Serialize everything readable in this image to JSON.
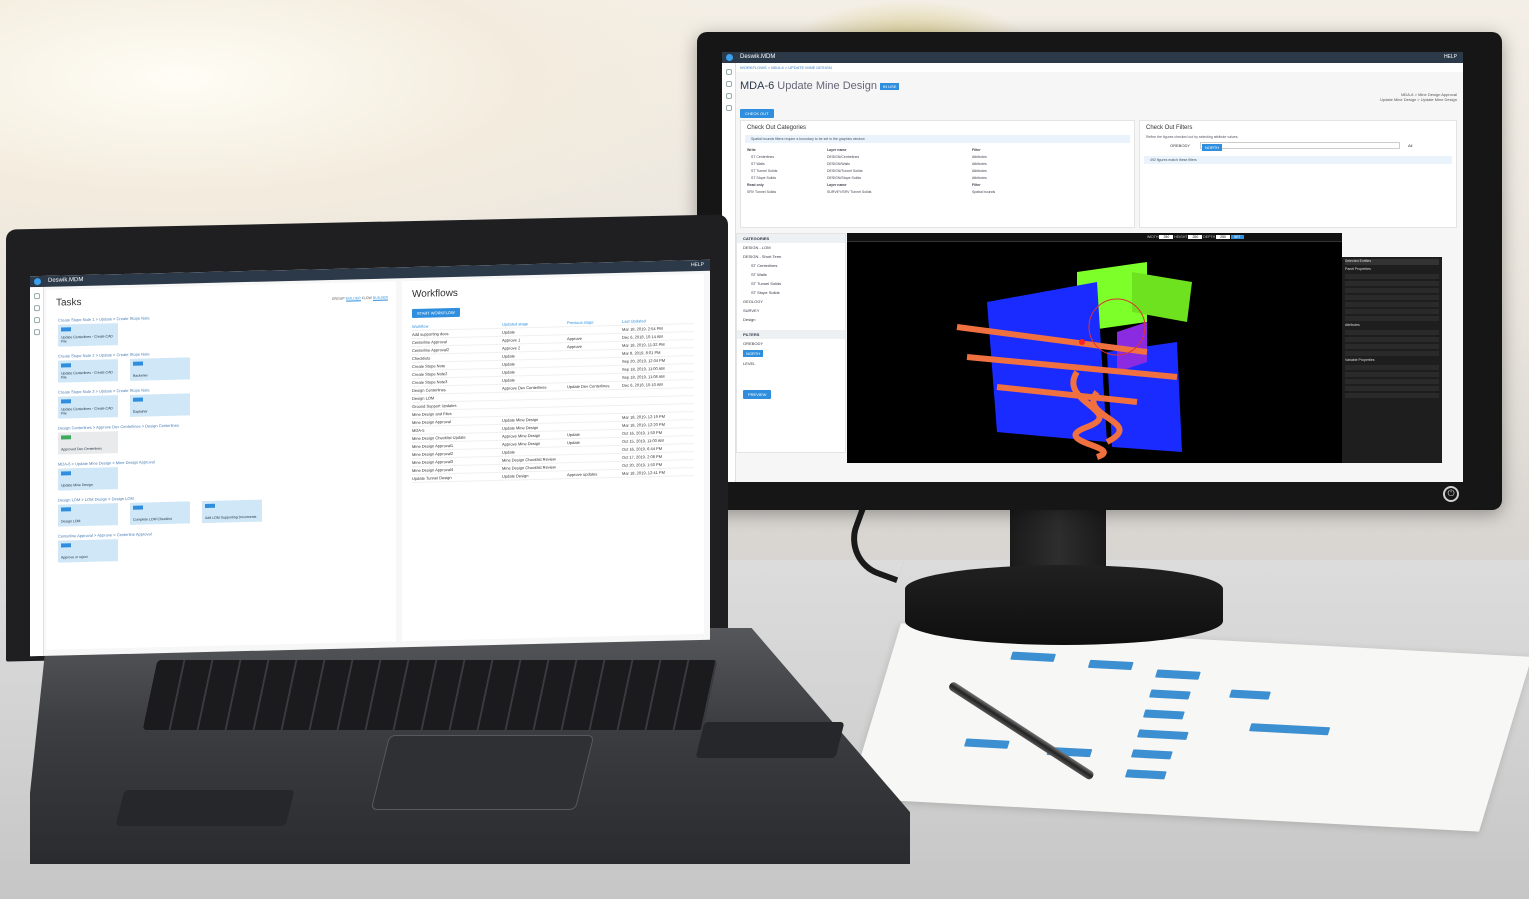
{
  "laptop_app": {
    "brand": "Deswik.MDM",
    "help": "HELP",
    "tasks": {
      "title": "Tasks",
      "filters": {
        "group_label": "GROUP",
        "group_value": "BUILDER",
        "flow_label": "FLOW",
        "flow_value": "BUILDER"
      },
      "rows": [
        {
          "header": "Create Stope Note 1 > Update > Create Stope Note",
          "cards": [
            "Update Centerlines - Create CAD File"
          ]
        },
        {
          "header": "Create Stope Note 2 > Update > Create Stope Note",
          "cards": [
            "Update Centerlines - Create CAD File",
            "Backener"
          ]
        },
        {
          "header": "Create Stope Note 3 > Update > Create Stope Note",
          "cards": [
            "Update Centerlines - Create CAD File",
            "Explainer"
          ]
        },
        {
          "header": "Design Centerlines > Approve Dev Centerlines > Design Centerlines",
          "cards": [
            "Approved Dev Centerlines"
          ]
        },
        {
          "header": "MDA-6 > Update Mine Design > Mine Design Approval",
          "cards": [
            "Update Mine Design"
          ]
        },
        {
          "header": "Design LOM > LOM Design > Design LOM",
          "cards": [
            "Design LOM",
            "Complete LOM Checklist",
            "Add LOM Supporting Documents"
          ]
        },
        {
          "header": "Centerline Approval > Approve > Centerline Approval",
          "cards": [
            "Approve or reject"
          ]
        }
      ]
    },
    "workflows": {
      "title": "Workflows",
      "start_button": "START WORKFLOW",
      "columns": [
        "Workflow",
        "Updated stage",
        "Previous stage",
        "Last Updated"
      ],
      "rows": [
        {
          "name": "Add supporting docs",
          "stage": "Update",
          "date": "Mar 18, 2019, 2:54 PM"
        },
        {
          "name": "Centerline Approval",
          "stage": "Approve 1",
          "prev": "Approve",
          "date": "Dec 6, 2018, 10:14 AM"
        },
        {
          "name": "Centerline Approval2",
          "stage": "Approve 2",
          "prev": "Approve",
          "date": "Mar 18, 2019, 11:32 PM"
        },
        {
          "name": "Checklists",
          "stage": "Update",
          "date": "Mar 8, 2019, 8:01 PM"
        },
        {
          "name": "Create Stope Note",
          "stage": "Update",
          "date": "Sep 20, 2019, 12:04 PM"
        },
        {
          "name": "Create Stope Note2",
          "stage": "Update",
          "date": "Sep 18, 2019, 11:00 AM"
        },
        {
          "name": "Create Stope Note3",
          "stage": "Update",
          "date": "Sep 18, 2019, 11:08 AM"
        },
        {
          "name": "Design Centerlines",
          "stage": "Approve Dev Centerlines",
          "prev": "Update Dev Centerlines",
          "date": "Dec 6, 2018, 10:10 AM"
        },
        {
          "name": "Design LOM",
          "stage": "",
          "date": ""
        },
        {
          "name": "Ground Support Updates",
          "stage": "",
          "date": ""
        },
        {
          "name": "Mine Design and Files",
          "stage": "",
          "date": ""
        },
        {
          "name": "Mine Design Approval",
          "stage": "Update Mine Design",
          "date": "Mar 18, 2019, 12:19 PM"
        },
        {
          "name": "MDA-5",
          "stage": "Update Mine Design",
          "date": "Mar 18, 2019, 12:20 PM"
        },
        {
          "name": "Mine Design Checklist Update",
          "stage": "Approve Mine Design",
          "prev": "Update",
          "date": "Oct 16, 2019, 1:50 PM"
        },
        {
          "name": "Mine Design Approval1",
          "stage": "Approve Mine Design",
          "prev": "Update",
          "date": "Oct 15, 2019, 11:00 AM"
        },
        {
          "name": "Mine Design Approval2",
          "stage": "Update",
          "date": "Oct 16, 2019, 6:44 PM"
        },
        {
          "name": "Mine Design Approval3",
          "stage": "Mine Design Checklist Review",
          "date": "Oct 17, 2019, 2:08 PM"
        },
        {
          "name": "Mine Design Approval4",
          "stage": "Mine Design Checklist Review",
          "date": "Oct 20, 2019, 1:50 PM"
        },
        {
          "name": "Update Tunnel Design",
          "stage": "Update Design",
          "prev": "Approve updates",
          "date": "Mar 18, 2019, 12:41 PM"
        }
      ]
    }
  },
  "monitor_app": {
    "brand": "Deswik.MDM",
    "help": "HELP",
    "breadcrumb": "WORKFLOWS > MDA-6 > UPDATE MINE DESIGN",
    "title_id": "MDA-6",
    "title_text": "Update Mine Design",
    "badge": "IN USE",
    "right_crumb_top": "MDA-6 > Mine Design Approval",
    "right_crumb_bottom": "Update Mine Design > Update Mine Design",
    "checkout_button": "CHECK OUT",
    "categories": {
      "title": "Check Out Categories",
      "info": "Spatial bounds filters require a boundary to be set in the graphics window",
      "write_label": "Write",
      "layer_label": "Layer name",
      "filter_label": "Filter",
      "write_rows": [
        {
          "name": "ST Centerlines",
          "layer": "DESIGN/Centrelines",
          "filter": "Attributes"
        },
        {
          "name": "ST Walls",
          "layer": "DESIGN/Walls",
          "filter": "Attributes"
        },
        {
          "name": "ST Tunnel Solids",
          "layer": "DESIGN/Tunnel Solids",
          "filter": "Attributes"
        },
        {
          "name": "ST Stope Solids",
          "layer": "DESIGN/Stope Solids",
          "filter": "Attributes"
        }
      ],
      "read_label": "Read only",
      "read_rows": [
        {
          "name": "SRV Tunnel Solids",
          "layer": "SURVEY/SRV Tunnel Solids",
          "filter": "Spatial bounds"
        }
      ]
    },
    "filters": {
      "title": "Check Out Filters",
      "info": "Refine the figures checked out by selecting attribute values.",
      "field_label": "OREBODY",
      "chip": "NORTH",
      "toggle_label": "All",
      "result": "492 figures match these filters"
    },
    "tree": {
      "header": "CATEGORIES",
      "items": [
        "DESIGN - LOM",
        "DESIGN - Short Term",
        "ST Centerlines",
        "ST Walls",
        "ST Tunnel Solids",
        "ST Stope Solids",
        "GEOLOGY",
        "SURVEY",
        "Design"
      ],
      "filters_header": "FILTERS",
      "orebody_label": "OREBODY",
      "orebody_chip": "NORTH",
      "level_label": "LEVEL",
      "preview_button": "PREVIEW"
    },
    "viewer": {
      "width_label": "WIDTH",
      "width_value": "250",
      "height_label": "HEIGHT",
      "height_value": "250",
      "depth_label": "DEPTH",
      "depth_value": "250",
      "set_button": "SET"
    },
    "properties": {
      "header": "Selected Entities",
      "sections": [
        "Panel Properties",
        "Attributes",
        "Variable Properties"
      ]
    }
  },
  "colors": {
    "app_topbar": "#2b3948",
    "accent": "#2f8fde",
    "card": "#cfe7f7",
    "tunnel": "#f07040",
    "stope": "#7dff2a",
    "solid": "#1a2bff",
    "walls": "#8a2be2"
  }
}
